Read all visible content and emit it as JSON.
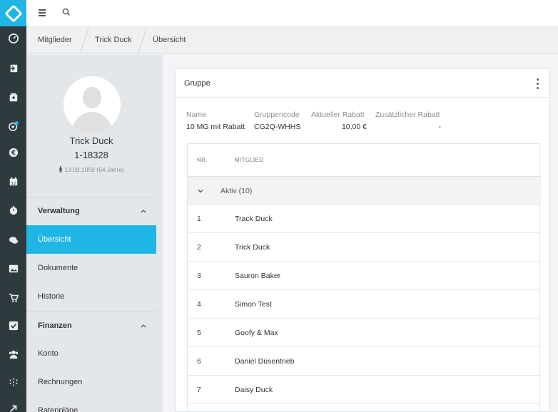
{
  "app": {
    "logo_icon": "diamond-logo",
    "accent_color": "#1fb6e6"
  },
  "rail": [
    "dashboard-icon",
    "login-icon",
    "contact-card-icon",
    "target-icon",
    "euro-icon",
    "calendar-icon",
    "stopwatch-icon",
    "chat-icon",
    "image-icon",
    "cart-icon",
    "checkbox-icon",
    "group-icon",
    "dots-icon",
    "arrow-icon"
  ],
  "breadcrumb": {
    "items": [
      "Mitglieder",
      "Trick Duck",
      "Übersicht"
    ]
  },
  "profile": {
    "name": "Trick Duck",
    "member_id": "1-18328",
    "birthdate": "13.09.1959 (64 Jahre)"
  },
  "nav": {
    "sections": [
      {
        "title": "Verwaltung",
        "items": [
          "Übersicht",
          "Dokumente",
          "Historie"
        ]
      },
      {
        "title": "Finanzen",
        "items": [
          "Konto",
          "Rechnungen",
          "Ratenpläne"
        ]
      }
    ],
    "active": "Übersicht"
  },
  "group": {
    "title": "Gruppe",
    "labels": {
      "name": "Name",
      "code": "Gruppencode",
      "discount": "Aktueller Rabatt",
      "extra": "Zusätzlicher Rabatt"
    },
    "values": {
      "name": "10 MG mit Rabatt",
      "code": "CG2Q-WHHS",
      "discount": "10,00 €",
      "extra": "-"
    },
    "table": {
      "headers": {
        "nr": "NR.",
        "member": "MITGLIED"
      },
      "group_label": "Aktiv (10)",
      "rows": [
        {
          "nr": "1",
          "name": "Track Duck"
        },
        {
          "nr": "2",
          "name": "Trick Duck"
        },
        {
          "nr": "3",
          "name": "Sauron Baker"
        },
        {
          "nr": "4",
          "name": "Simon Test"
        },
        {
          "nr": "5",
          "name": "Goofy & Max"
        },
        {
          "nr": "6",
          "name": "Daniel Düsentrieb"
        },
        {
          "nr": "7",
          "name": "Daisy Duck"
        }
      ]
    }
  }
}
